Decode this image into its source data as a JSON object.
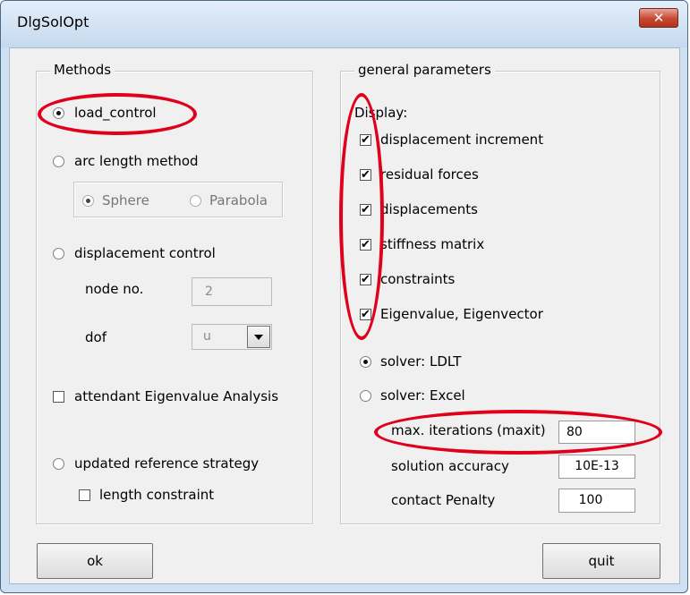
{
  "window": {
    "title": "DlgSolOpt",
    "close_glyph": "✕"
  },
  "methods": {
    "group_label": "Methods",
    "load_control": "load_control",
    "arc_length": "arc length method",
    "sphere": "Sphere",
    "parabola": "Parabola",
    "displacement_control": "displacement control",
    "node_no_label": "node no.",
    "node_no_value": "2",
    "dof_label": "dof",
    "dof_value": "u",
    "eigen_analysis": "attendant Eigenvalue Analysis",
    "updated_reference": "updated reference strategy",
    "length_constraint": "length constraint"
  },
  "general": {
    "group_label": "general parameters",
    "display_label": "Display:",
    "display_items": [
      "displacement increment",
      "residual forces",
      "displacements",
      "stiffness matrix",
      "constraints",
      "Eigenvalue, Eigenvector"
    ],
    "solver_ldlt": "solver: LDLT",
    "solver_excel": "solver: Excel",
    "maxit_label": "max. iterations (maxit)",
    "maxit_value": "80",
    "accuracy_label": "solution accuracy",
    "accuracy_value": "10E-13",
    "penalty_label": "contact Penalty",
    "penalty_value": "100"
  },
  "buttons": {
    "ok": "ok",
    "quit": "quit"
  },
  "colors": {
    "highlight": "#e0001b",
    "titlebar": "#c5d9ee",
    "close": "#c6472f"
  }
}
